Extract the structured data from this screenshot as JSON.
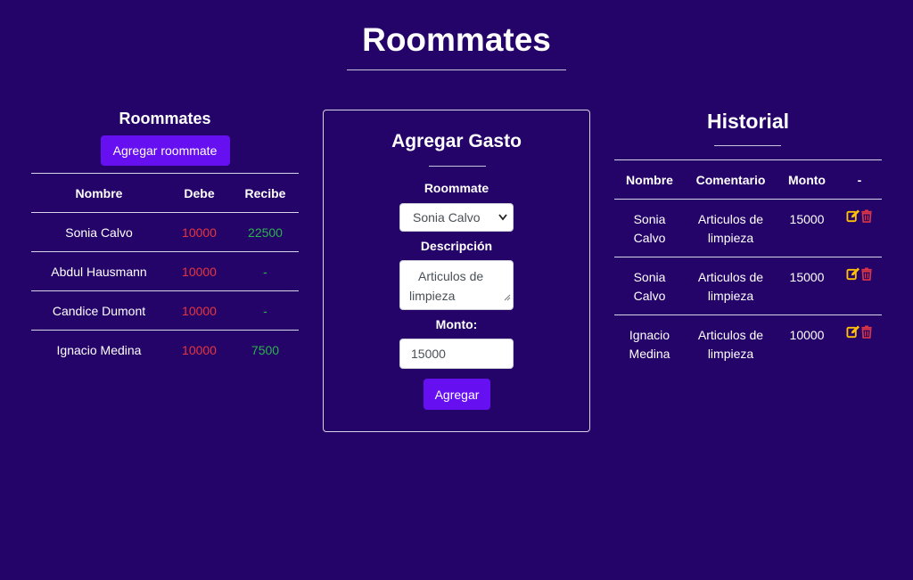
{
  "page": {
    "title": "Roommates"
  },
  "roommates": {
    "heading": "Roommates",
    "add_button": "Agregar roommate",
    "columns": [
      "Nombre",
      "Debe",
      "Recibe"
    ],
    "rows": [
      {
        "nombre": "Sonia Calvo",
        "debe": "10000",
        "recibe": "22500"
      },
      {
        "nombre": "Abdul Hausmann",
        "debe": "10000",
        "recibe": "-"
      },
      {
        "nombre": "Candice Dumont",
        "debe": "10000",
        "recibe": "-"
      },
      {
        "nombre": "Ignacio Medina",
        "debe": "10000",
        "recibe": "7500"
      }
    ]
  },
  "form": {
    "title": "Agregar Gasto",
    "roommate_label": "Roommate",
    "roommate_selected": "Sonia Calvo",
    "descripcion_label": "Descripción",
    "descripcion_value": "Articulos de limpieza",
    "monto_label": "Monto:",
    "monto_value": "15000",
    "submit_label": "Agregar"
  },
  "historial": {
    "title": "Historial",
    "columns": [
      "Nombre",
      "Comentario",
      "Monto",
      "-"
    ],
    "rows": [
      {
        "nombre": "Sonia Calvo",
        "comentario": "Articulos de limpieza",
        "monto": "15000"
      },
      {
        "nombre": "Sonia Calvo",
        "comentario": "Articulos de limpieza",
        "monto": "15000"
      },
      {
        "nombre": "Ignacio Medina",
        "comentario": "Articulos de limpieza",
        "monto": "10000"
      }
    ]
  },
  "colors": {
    "background": "#240468",
    "button": "#6610f2",
    "debe": "#e8343d",
    "recibe": "#2bb24c",
    "edit_icon": "#ffc107",
    "delete_icon": "#dc3545"
  },
  "icons": {
    "edit": "edit-icon",
    "delete": "trash-icon"
  }
}
